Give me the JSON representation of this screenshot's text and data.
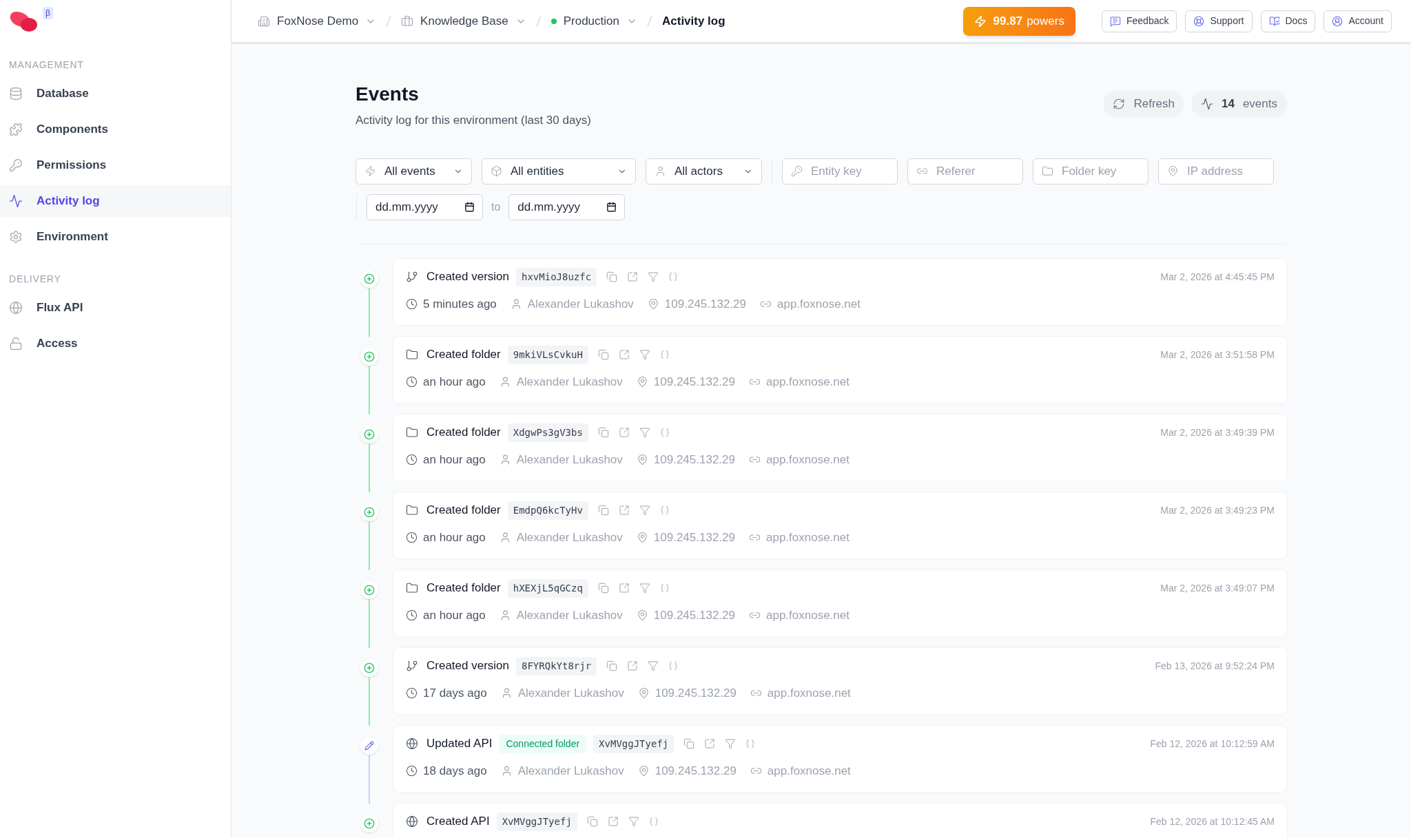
{
  "sidebar": {
    "beta_badge": "β",
    "sections": [
      {
        "title": "MANAGEMENT",
        "items": [
          {
            "label": "Database",
            "selected": false
          },
          {
            "label": "Components",
            "selected": false
          },
          {
            "label": "Permissions",
            "selected": false
          },
          {
            "label": "Activity log",
            "selected": true
          },
          {
            "label": "Environment",
            "selected": false
          }
        ]
      },
      {
        "title": "DELIVERY",
        "items": [
          {
            "label": "Flux API",
            "selected": false
          },
          {
            "label": "Access",
            "selected": false
          }
        ]
      }
    ]
  },
  "breadcrumbs": [
    {
      "label": "FoxNose Demo",
      "kind": "organization"
    },
    {
      "label": "Knowledge Base",
      "kind": "project"
    },
    {
      "label": "Production",
      "kind": "environment"
    },
    {
      "label": "Activity log",
      "kind": "current"
    }
  ],
  "powers": {
    "value": "99.87",
    "unit": "powers"
  },
  "header_buttons": [
    {
      "label": "Feedback"
    },
    {
      "label": "Support"
    },
    {
      "label": "Docs"
    },
    {
      "label": "Account"
    }
  ],
  "page": {
    "title": "Events",
    "subtitle": "Activity log for this environment (last 30 days)",
    "refresh": "Refresh",
    "count": "14",
    "count_unit": "events"
  },
  "filters": {
    "selects": [
      {
        "label": "All events"
      },
      {
        "label": "All entities"
      },
      {
        "label": "All actors"
      }
    ],
    "inputs": [
      {
        "placeholder": "Entity key"
      },
      {
        "placeholder": "Referer"
      },
      {
        "placeholder": "Folder key"
      },
      {
        "placeholder": "IP address"
      }
    ],
    "date_from": {
      "placeholder": "dd.mm.yyyy"
    },
    "date_separator": "to",
    "date_to": {
      "placeholder": "dd.mm.yyyy"
    }
  },
  "events": [
    {
      "kind": "created",
      "title": "Created version",
      "key": "hxvMioJ8uzfc",
      "date": "Mar 2, 2026 at 4:45:45 PM",
      "time": "5 minutes ago",
      "actor": "Alexander Lukashov",
      "ip": "109.245.132.29",
      "referer": "app.foxnose.net"
    },
    {
      "kind": "created",
      "title": "Created folder",
      "key": "9mkiVLsCvkuH",
      "date": "Mar 2, 2026 at 3:51:58 PM",
      "time": "an hour ago",
      "actor": "Alexander Lukashov",
      "ip": "109.245.132.29",
      "referer": "app.foxnose.net"
    },
    {
      "kind": "created",
      "title": "Created folder",
      "key": "XdgwPs3gV3bs",
      "date": "Mar 2, 2026 at 3:49:39 PM",
      "time": "an hour ago",
      "actor": "Alexander Lukashov",
      "ip": "109.245.132.29",
      "referer": "app.foxnose.net"
    },
    {
      "kind": "created",
      "title": "Created folder",
      "key": "EmdpQ6kcTyHv",
      "date": "Mar 2, 2026 at 3:49:23 PM",
      "time": "an hour ago",
      "actor": "Alexander Lukashov",
      "ip": "109.245.132.29",
      "referer": "app.foxnose.net"
    },
    {
      "kind": "created",
      "title": "Created folder",
      "key": "hXEXjL5qGCzq",
      "date": "Mar 2, 2026 at 3:49:07 PM",
      "time": "an hour ago",
      "actor": "Alexander Lukashov",
      "ip": "109.245.132.29",
      "referer": "app.foxnose.net"
    },
    {
      "kind": "created",
      "title": "Created version",
      "key": "8FYRQkYt8rjr",
      "date": "Feb 13, 2026 at 9:52:24 PM",
      "time": "17 days ago",
      "actor": "Alexander Lukashov",
      "ip": "109.245.132.29",
      "referer": "app.foxnose.net"
    },
    {
      "kind": "updated",
      "title": "Updated API",
      "tag": "Connected folder",
      "key": "XvMVggJTyefj",
      "date": "Feb 12, 2026 at 10:12:59 AM",
      "time": "18 days ago",
      "actor": "Alexander Lukashov",
      "ip": "109.245.132.29",
      "referer": "app.foxnose.net"
    },
    {
      "kind": "created",
      "title": "Created API",
      "key": "XvMVggJTyefj",
      "date": "Feb 12, 2026 at 10:12:45 AM"
    }
  ]
}
